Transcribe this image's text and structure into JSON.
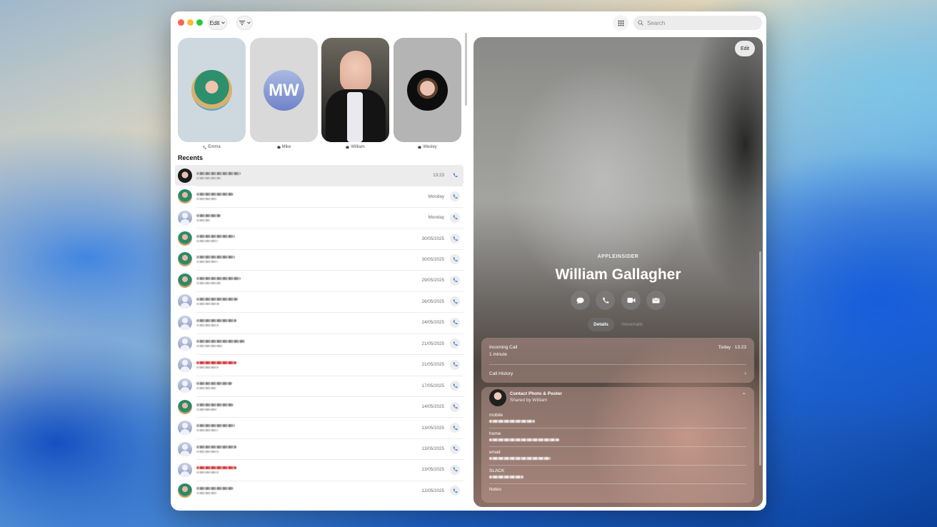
{
  "toolbar": {
    "edit_label": "Edit",
    "search_placeholder": "Search"
  },
  "favorites": [
    {
      "name": "Emma",
      "type": "phone"
    },
    {
      "name": "Mike",
      "type": "message",
      "initials": "MW"
    },
    {
      "name": "William",
      "type": "message"
    },
    {
      "name": "Wesley",
      "type": "message"
    }
  ],
  "recents_title": "Recents",
  "recents": [
    {
      "date": "13:23",
      "avatar": "william",
      "red": false
    },
    {
      "date": "Monday",
      "avatar": "emma",
      "red": false
    },
    {
      "date": "Monday",
      "avatar": "generic",
      "red": false
    },
    {
      "date": "30/05/2025",
      "avatar": "emma",
      "red": false
    },
    {
      "date": "30/05/2025",
      "avatar": "emma",
      "red": false
    },
    {
      "date": "29/05/2025",
      "avatar": "emma",
      "red": false
    },
    {
      "date": "26/05/2025",
      "avatar": "generic",
      "red": false
    },
    {
      "date": "24/05/2025",
      "avatar": "generic",
      "red": false
    },
    {
      "date": "21/05/2025",
      "avatar": "generic",
      "red": false
    },
    {
      "date": "21/05/2025",
      "avatar": "generic",
      "red": true
    },
    {
      "date": "17/05/2025",
      "avatar": "generic",
      "red": false
    },
    {
      "date": "14/05/2025",
      "avatar": "emma",
      "red": false
    },
    {
      "date": "13/05/2025",
      "avatar": "generic",
      "red": false
    },
    {
      "date": "13/05/2025",
      "avatar": "generic",
      "red": false
    },
    {
      "date": "13/05/2025",
      "avatar": "generic",
      "red": true
    },
    {
      "date": "12/05/2025",
      "avatar": "emma",
      "red": false
    }
  ],
  "detail": {
    "edit_label": "Edit",
    "organization": "APPLEINSIDER",
    "name": "William Gallagher",
    "tabs": {
      "details": "Details",
      "voicemails": "Voicemails"
    },
    "last_call": {
      "title": "Incoming Call",
      "duration": "1 minute",
      "time": "Today · 13:23"
    },
    "call_history": "Call History",
    "poster": {
      "title": "Contact Photo & Poster",
      "subtitle": "Shared by William"
    },
    "fields": {
      "mobile": "mobile",
      "home": "home",
      "email": "email",
      "slack": "SLACK",
      "notes": "Notes"
    }
  },
  "colors": {
    "accent": "#2a6ee0",
    "missed": "#e04848"
  }
}
